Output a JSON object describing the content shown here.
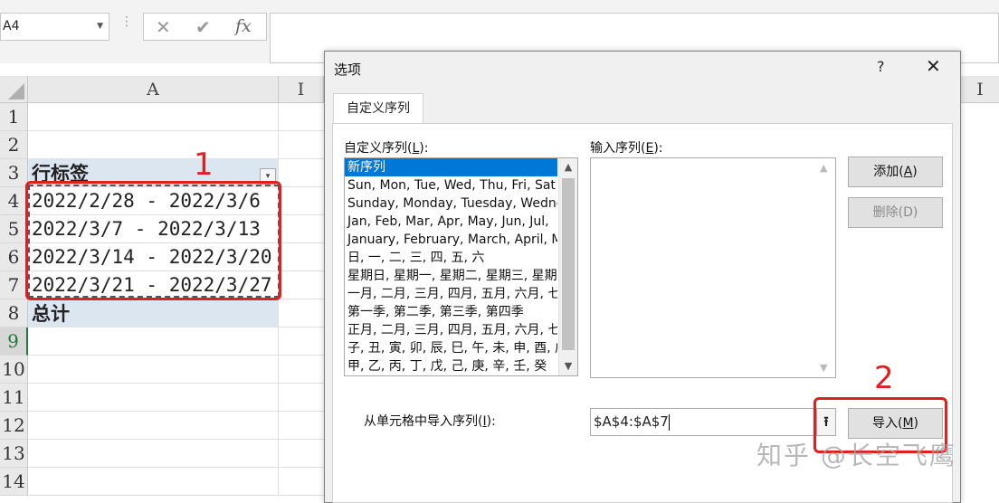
{
  "formula_bar": {
    "name_box": "A4",
    "cancel_icon": "✕",
    "enter_icon": "✔",
    "fx_label": "fx",
    "formula_value": ""
  },
  "grid": {
    "columns": [
      "A",
      "I"
    ],
    "partial_column": "I",
    "rows": [
      {
        "num": "1",
        "value": ""
      },
      {
        "num": "2",
        "value": ""
      },
      {
        "num": "3",
        "value": "行标签"
      },
      {
        "num": "4",
        "value": "2022/2/28 - 2022/3/6"
      },
      {
        "num": "5",
        "value": "2022/3/7 - 2022/3/13"
      },
      {
        "num": "6",
        "value": "2022/3/14 - 2022/3/20"
      },
      {
        "num": "7",
        "value": "2022/3/21 - 2022/3/27"
      },
      {
        "num": "8",
        "value": "总计"
      },
      {
        "num": "9",
        "value": ""
      },
      {
        "num": "10",
        "value": ""
      },
      {
        "num": "11",
        "value": ""
      },
      {
        "num": "12",
        "value": ""
      },
      {
        "num": "13",
        "value": ""
      },
      {
        "num": "14",
        "value": ""
      }
    ],
    "filter_icon": "▾"
  },
  "annotations": {
    "step1": "1",
    "step2": "2"
  },
  "dialog": {
    "title": "选项",
    "help": "?",
    "close": "✕",
    "tab": "自定义序列",
    "custom_lists_label": "自定义序列(",
    "custom_lists_key": "L",
    "custom_lists_suffix": "):",
    "input_label": "输入序列(",
    "input_key": "E",
    "input_suffix": "):",
    "custom_lists": [
      "新序列",
      "Sun, Mon, Tue, Wed, Thu, Fri, Sat",
      "Sunday, Monday, Tuesday, Wednesday",
      "Jan, Feb, Mar, Apr, May, Jun, Jul,",
      "January, February, March, April, M",
      "日, 一, 二, 三, 四, 五, 六",
      "星期日, 星期一, 星期二, 星期三, 星期四",
      "一月, 二月, 三月, 四月, 五月, 六月, 七",
      "第一季, 第二季, 第三季, 第四季",
      "正月, 二月, 三月, 四月, 五月, 六月, 七",
      "子, 丑, 寅, 卯, 辰, 巳, 午, 未, 申, 酉, 戌",
      "甲, 乙, 丙, 丁, 戊, 己, 庚, 辛, 壬, 癸"
    ],
    "add_button": "添加(",
    "add_key": "A",
    "add_suffix": ")",
    "delete_button": "删除(D)",
    "import_label": "从单元格中导入序列(",
    "import_key": "I",
    "import_suffix": "):",
    "import_value": "$A$4:$A$7",
    "import_button": "导入(",
    "import_btn_key": "M",
    "import_btn_suffix": ")"
  },
  "watermark": "知乎 @长空飞鹰"
}
